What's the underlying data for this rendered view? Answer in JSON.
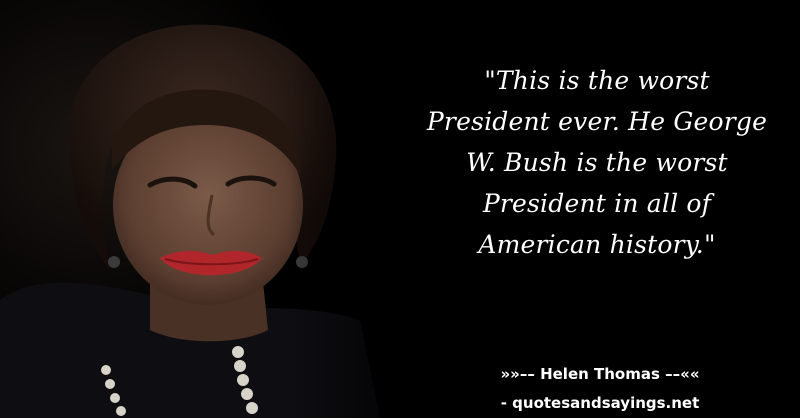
{
  "quote": {
    "text": "\"This is the worst President ever. He George W. Bush is the worst President in all of American history.\"",
    "lines": [
      "\"This is the worst",
      "President ever. He George",
      "W. Bush is the worst",
      "President in all of",
      "American history.\""
    ]
  },
  "attribution": {
    "text": "»»–– Helen Thomas ––««"
  },
  "source": {
    "text": "- quotesandsayings.net"
  },
  "colors": {
    "background": "#000000",
    "text": "#ffffff",
    "lips": "#b0262a",
    "skin": "#6a4a3a",
    "hair": "#2a1b14",
    "garment": "#0e0e12"
  }
}
